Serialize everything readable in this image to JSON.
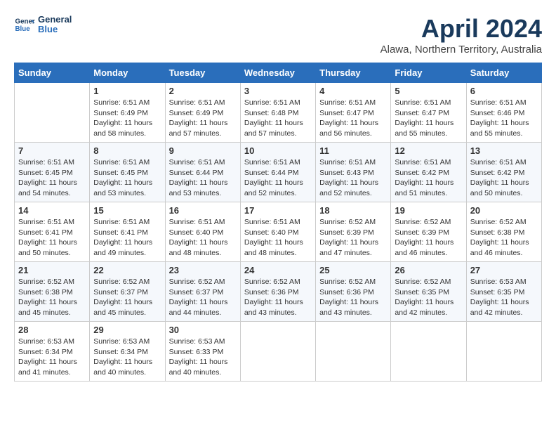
{
  "header": {
    "logo_line1": "General",
    "logo_line2": "Blue",
    "month_title": "April 2024",
    "subtitle": "Alawa, Northern Territory, Australia"
  },
  "days_of_week": [
    "Sunday",
    "Monday",
    "Tuesday",
    "Wednesday",
    "Thursday",
    "Friday",
    "Saturday"
  ],
  "weeks": [
    [
      {
        "day": "",
        "sunrise": "",
        "sunset": "",
        "daylight": ""
      },
      {
        "day": "1",
        "sunrise": "Sunrise: 6:51 AM",
        "sunset": "Sunset: 6:49 PM",
        "daylight": "Daylight: 11 hours and 58 minutes."
      },
      {
        "day": "2",
        "sunrise": "Sunrise: 6:51 AM",
        "sunset": "Sunset: 6:49 PM",
        "daylight": "Daylight: 11 hours and 57 minutes."
      },
      {
        "day": "3",
        "sunrise": "Sunrise: 6:51 AM",
        "sunset": "Sunset: 6:48 PM",
        "daylight": "Daylight: 11 hours and 57 minutes."
      },
      {
        "day": "4",
        "sunrise": "Sunrise: 6:51 AM",
        "sunset": "Sunset: 6:47 PM",
        "daylight": "Daylight: 11 hours and 56 minutes."
      },
      {
        "day": "5",
        "sunrise": "Sunrise: 6:51 AM",
        "sunset": "Sunset: 6:47 PM",
        "daylight": "Daylight: 11 hours and 55 minutes."
      },
      {
        "day": "6",
        "sunrise": "Sunrise: 6:51 AM",
        "sunset": "Sunset: 6:46 PM",
        "daylight": "Daylight: 11 hours and 55 minutes."
      }
    ],
    [
      {
        "day": "7",
        "sunrise": "Sunrise: 6:51 AM",
        "sunset": "Sunset: 6:45 PM",
        "daylight": "Daylight: 11 hours and 54 minutes."
      },
      {
        "day": "8",
        "sunrise": "Sunrise: 6:51 AM",
        "sunset": "Sunset: 6:45 PM",
        "daylight": "Daylight: 11 hours and 53 minutes."
      },
      {
        "day": "9",
        "sunrise": "Sunrise: 6:51 AM",
        "sunset": "Sunset: 6:44 PM",
        "daylight": "Daylight: 11 hours and 53 minutes."
      },
      {
        "day": "10",
        "sunrise": "Sunrise: 6:51 AM",
        "sunset": "Sunset: 6:44 PM",
        "daylight": "Daylight: 11 hours and 52 minutes."
      },
      {
        "day": "11",
        "sunrise": "Sunrise: 6:51 AM",
        "sunset": "Sunset: 6:43 PM",
        "daylight": "Daylight: 11 hours and 52 minutes."
      },
      {
        "day": "12",
        "sunrise": "Sunrise: 6:51 AM",
        "sunset": "Sunset: 6:42 PM",
        "daylight": "Daylight: 11 hours and 51 minutes."
      },
      {
        "day": "13",
        "sunrise": "Sunrise: 6:51 AM",
        "sunset": "Sunset: 6:42 PM",
        "daylight": "Daylight: 11 hours and 50 minutes."
      }
    ],
    [
      {
        "day": "14",
        "sunrise": "Sunrise: 6:51 AM",
        "sunset": "Sunset: 6:41 PM",
        "daylight": "Daylight: 11 hours and 50 minutes."
      },
      {
        "day": "15",
        "sunrise": "Sunrise: 6:51 AM",
        "sunset": "Sunset: 6:41 PM",
        "daylight": "Daylight: 11 hours and 49 minutes."
      },
      {
        "day": "16",
        "sunrise": "Sunrise: 6:51 AM",
        "sunset": "Sunset: 6:40 PM",
        "daylight": "Daylight: 11 hours and 48 minutes."
      },
      {
        "day": "17",
        "sunrise": "Sunrise: 6:51 AM",
        "sunset": "Sunset: 6:40 PM",
        "daylight": "Daylight: 11 hours and 48 minutes."
      },
      {
        "day": "18",
        "sunrise": "Sunrise: 6:52 AM",
        "sunset": "Sunset: 6:39 PM",
        "daylight": "Daylight: 11 hours and 47 minutes."
      },
      {
        "day": "19",
        "sunrise": "Sunrise: 6:52 AM",
        "sunset": "Sunset: 6:39 PM",
        "daylight": "Daylight: 11 hours and 46 minutes."
      },
      {
        "day": "20",
        "sunrise": "Sunrise: 6:52 AM",
        "sunset": "Sunset: 6:38 PM",
        "daylight": "Daylight: 11 hours and 46 minutes."
      }
    ],
    [
      {
        "day": "21",
        "sunrise": "Sunrise: 6:52 AM",
        "sunset": "Sunset: 6:38 PM",
        "daylight": "Daylight: 11 hours and 45 minutes."
      },
      {
        "day": "22",
        "sunrise": "Sunrise: 6:52 AM",
        "sunset": "Sunset: 6:37 PM",
        "daylight": "Daylight: 11 hours and 45 minutes."
      },
      {
        "day": "23",
        "sunrise": "Sunrise: 6:52 AM",
        "sunset": "Sunset: 6:37 PM",
        "daylight": "Daylight: 11 hours and 44 minutes."
      },
      {
        "day": "24",
        "sunrise": "Sunrise: 6:52 AM",
        "sunset": "Sunset: 6:36 PM",
        "daylight": "Daylight: 11 hours and 43 minutes."
      },
      {
        "day": "25",
        "sunrise": "Sunrise: 6:52 AM",
        "sunset": "Sunset: 6:36 PM",
        "daylight": "Daylight: 11 hours and 43 minutes."
      },
      {
        "day": "26",
        "sunrise": "Sunrise: 6:52 AM",
        "sunset": "Sunset: 6:35 PM",
        "daylight": "Daylight: 11 hours and 42 minutes."
      },
      {
        "day": "27",
        "sunrise": "Sunrise: 6:53 AM",
        "sunset": "Sunset: 6:35 PM",
        "daylight": "Daylight: 11 hours and 42 minutes."
      }
    ],
    [
      {
        "day": "28",
        "sunrise": "Sunrise: 6:53 AM",
        "sunset": "Sunset: 6:34 PM",
        "daylight": "Daylight: 11 hours and 41 minutes."
      },
      {
        "day": "29",
        "sunrise": "Sunrise: 6:53 AM",
        "sunset": "Sunset: 6:34 PM",
        "daylight": "Daylight: 11 hours and 40 minutes."
      },
      {
        "day": "30",
        "sunrise": "Sunrise: 6:53 AM",
        "sunset": "Sunset: 6:33 PM",
        "daylight": "Daylight: 11 hours and 40 minutes."
      },
      {
        "day": "",
        "sunrise": "",
        "sunset": "",
        "daylight": ""
      },
      {
        "day": "",
        "sunrise": "",
        "sunset": "",
        "daylight": ""
      },
      {
        "day": "",
        "sunrise": "",
        "sunset": "",
        "daylight": ""
      },
      {
        "day": "",
        "sunrise": "",
        "sunset": "",
        "daylight": ""
      }
    ]
  ]
}
